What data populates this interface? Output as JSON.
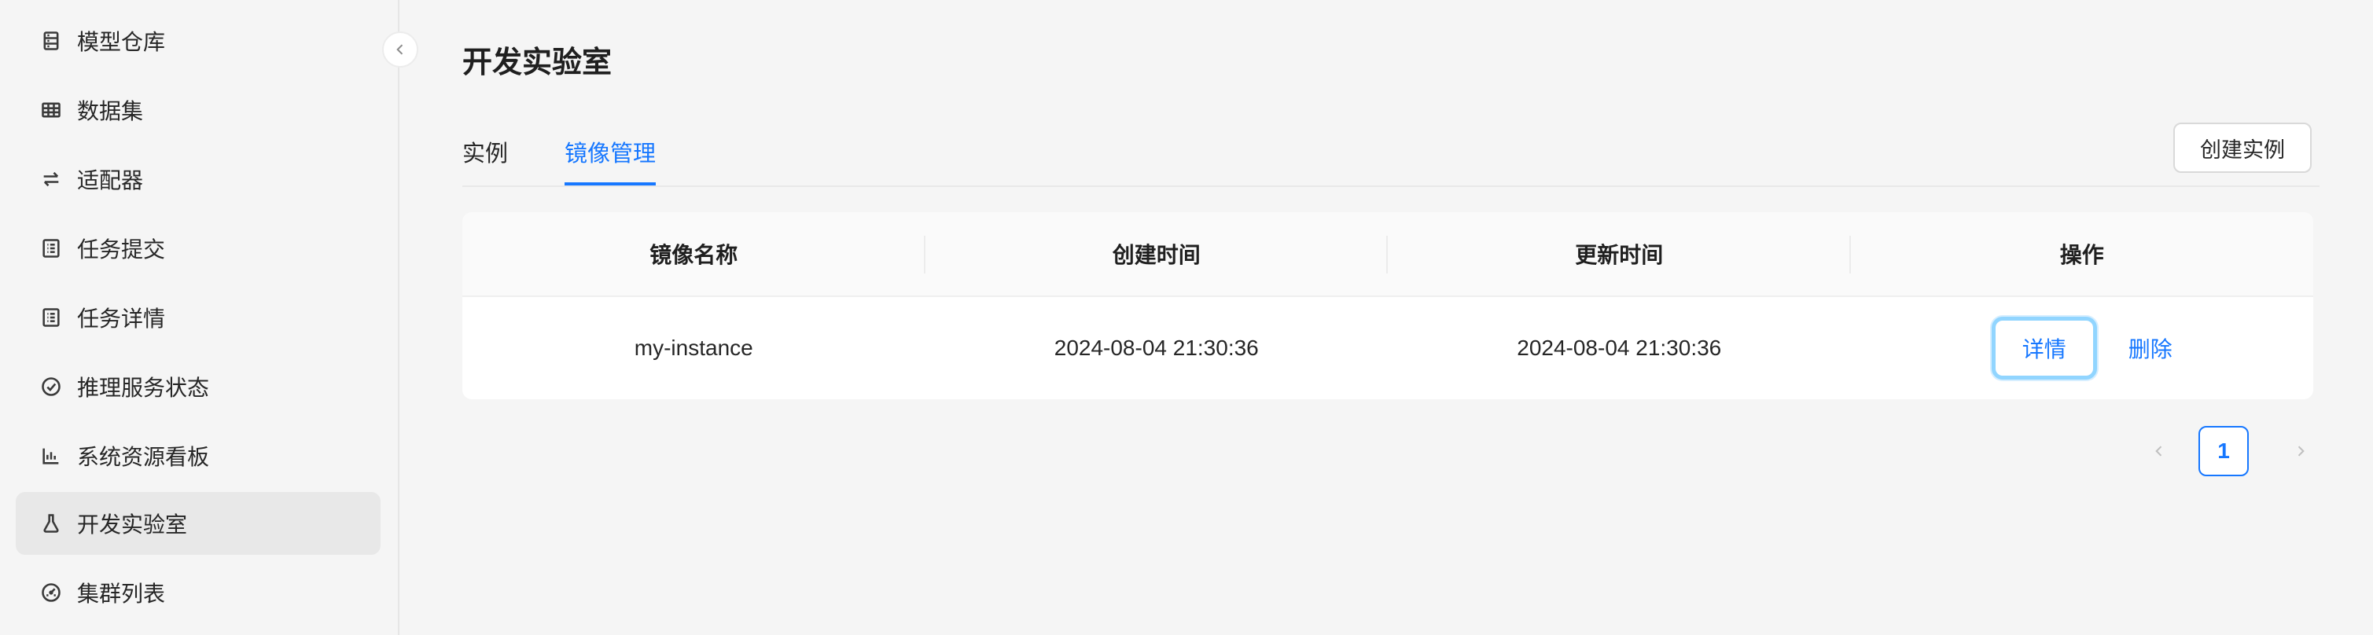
{
  "sidebar": {
    "items": [
      {
        "label": "模型仓库",
        "icon": "database-icon",
        "active": false
      },
      {
        "label": "数据集",
        "icon": "table-icon",
        "active": false
      },
      {
        "label": "适配器",
        "icon": "swap-icon",
        "active": false
      },
      {
        "label": "任务提交",
        "icon": "list-icon",
        "active": false
      },
      {
        "label": "任务详情",
        "icon": "list-icon",
        "active": false
      },
      {
        "label": "推理服务状态",
        "icon": "check-circle-icon",
        "active": false
      },
      {
        "label": "系统资源看板",
        "icon": "bar-chart-icon",
        "active": false
      },
      {
        "label": "开发实验室",
        "icon": "flask-icon",
        "active": true
      },
      {
        "label": "集群列表",
        "icon": "dashboard-icon",
        "active": false
      }
    ]
  },
  "header": {
    "title": "开发实验室"
  },
  "tabs": [
    {
      "label": "实例",
      "active": false
    },
    {
      "label": "镜像管理",
      "active": true
    }
  ],
  "toolbar": {
    "create_label": "创建实例"
  },
  "table": {
    "columns": [
      "镜像名称",
      "创建时间",
      "更新时间",
      "操作"
    ],
    "rows": [
      {
        "name": "my-instance",
        "created": "2024-08-04 21:30:36",
        "updated": "2024-08-04 21:30:36",
        "actions": {
          "detail": "详情",
          "delete": "删除"
        }
      }
    ]
  },
  "pagination": {
    "current": "1"
  },
  "colors": {
    "accent": "#1677ff",
    "focus_ring": "#91d5ff",
    "active_nav_bg": "#e8e8e8"
  }
}
